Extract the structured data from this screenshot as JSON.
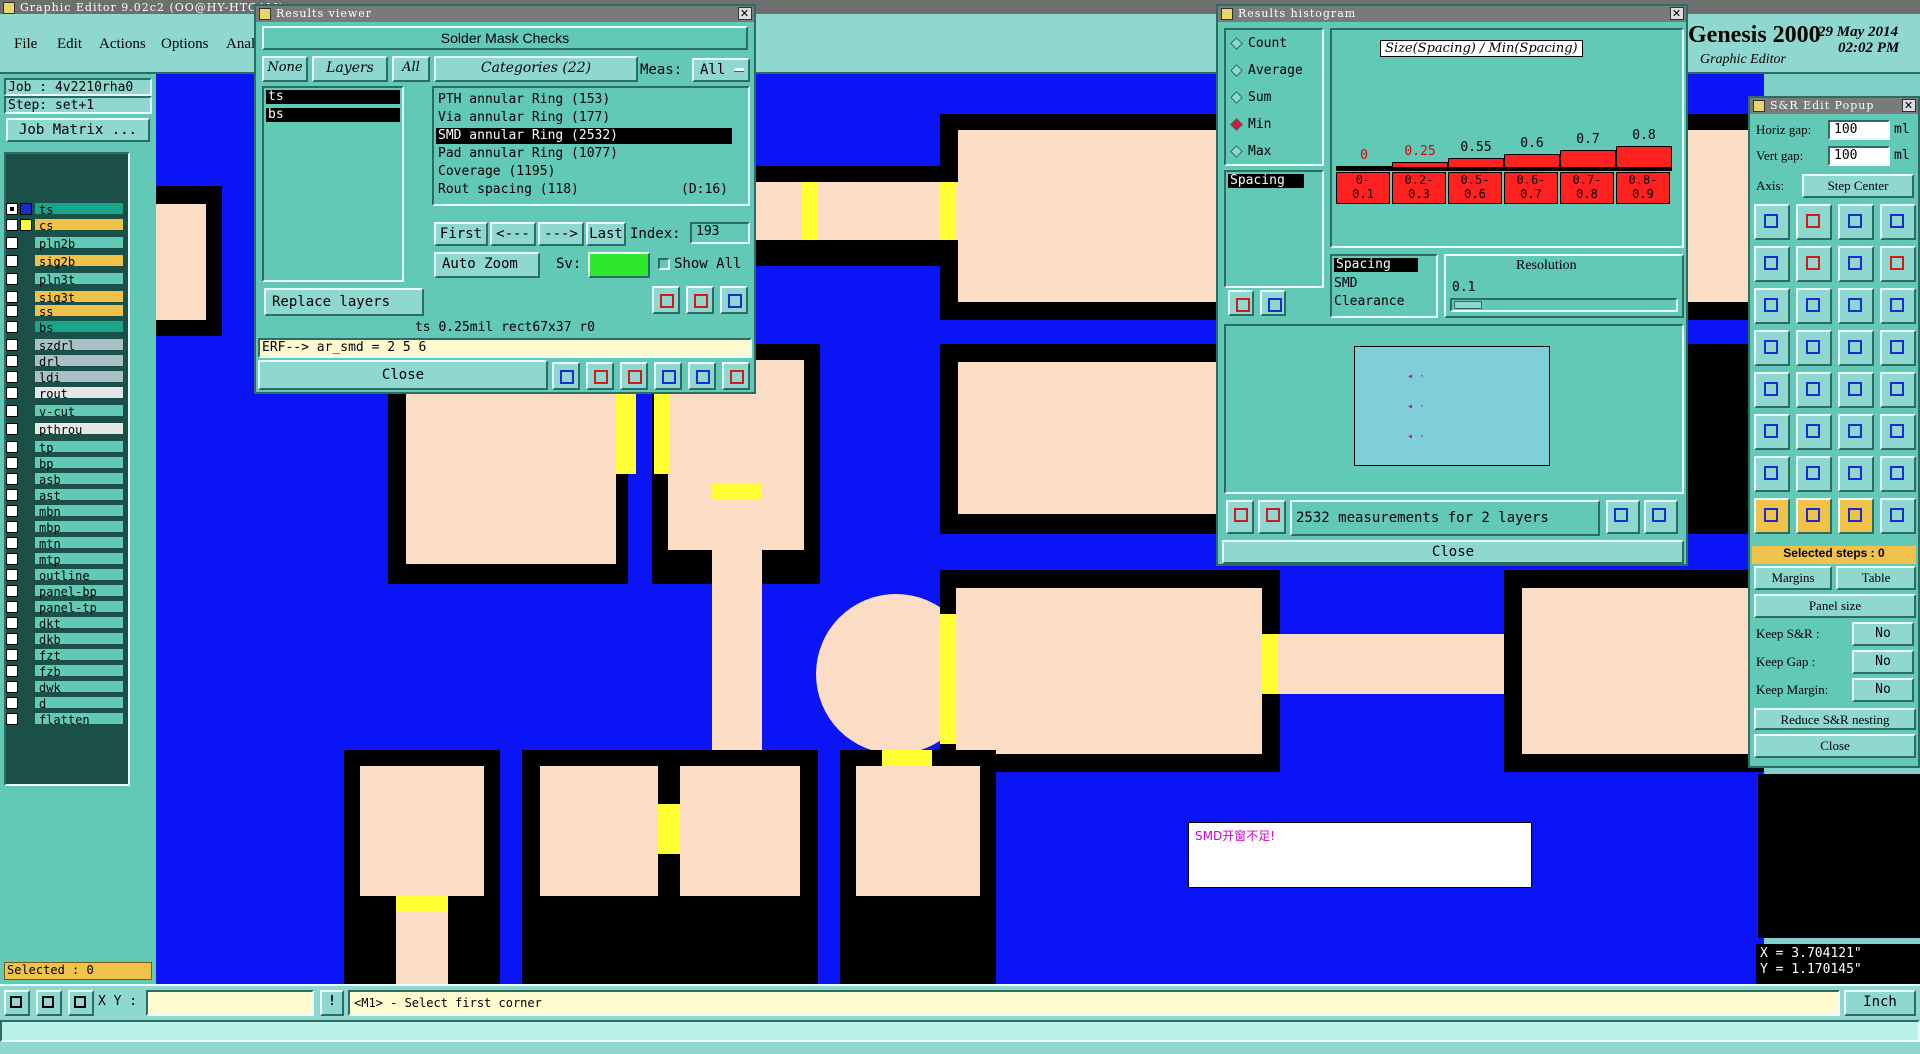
{
  "app": {
    "title": "Graphic Editor 9.02c2  (OO@HY-HTCAM)",
    "menus": [
      "File",
      "Edit",
      "Actions",
      "Options",
      "Anal"
    ],
    "brand": "Genesis 2000",
    "brand_sub": "Graphic Editor",
    "date": "29 May 2014",
    "time": "02:02 PM"
  },
  "left_panel": {
    "job": "Job : 4v2210rha0",
    "step": "Step: set+1",
    "job_matrix": "Job Matrix ...",
    "layers": [
      {
        "name": "ts",
        "color": "#1aa58a",
        "marker": "#1a2bd0",
        "selected": true
      },
      {
        "name": "cs",
        "color": "#f0c24a",
        "marker": "#ffff33"
      },
      {
        "name": "pln2b",
        "color": "#63c9b7"
      },
      {
        "name": "sig2b",
        "color": "#f0c24a"
      },
      {
        "name": "pln3t",
        "color": "#63c9b7"
      },
      {
        "name": "sig3t",
        "color": "#f0c24a"
      },
      {
        "name": "ss",
        "color": "#f0c24a"
      },
      {
        "name": "bs",
        "color": "#1aa58a"
      },
      {
        "name": "szdrl",
        "color": "#a9c0c6"
      },
      {
        "name": "drl",
        "color": "#a9c0c6"
      },
      {
        "name": "ldi",
        "color": "#a9c0c6"
      },
      {
        "name": "rout",
        "color": "#e6e6e6"
      },
      {
        "name": "v-cut",
        "color": "#63c9b7"
      },
      {
        "name": "pthrou",
        "color": "#e6e6e6"
      },
      {
        "name": "tp",
        "color": "#63c9b7"
      },
      {
        "name": "bp",
        "color": "#63c9b7"
      },
      {
        "name": "asb",
        "color": "#63c9b7"
      },
      {
        "name": "ast",
        "color": "#63c9b7"
      },
      {
        "name": "mbn",
        "color": "#63c9b7"
      },
      {
        "name": "mbp",
        "color": "#63c9b7"
      },
      {
        "name": "mtn",
        "color": "#63c9b7"
      },
      {
        "name": "mtp",
        "color": "#63c9b7"
      },
      {
        "name": "outline",
        "color": "#63c9b7"
      },
      {
        "name": "panel-bp",
        "color": "#63c9b7"
      },
      {
        "name": "panel-tp",
        "color": "#63c9b7"
      },
      {
        "name": "dkt",
        "color": "#63c9b7"
      },
      {
        "name": "dkb",
        "color": "#63c9b7"
      },
      {
        "name": "fzt",
        "color": "#63c9b7"
      },
      {
        "name": "fzb",
        "color": "#63c9b7"
      },
      {
        "name": "dwk",
        "color": "#63c9b7"
      },
      {
        "name": "d",
        "color": "#63c9b7"
      },
      {
        "name": "flatten",
        "color": "#63c9b7"
      }
    ],
    "selected": "Selected : 0"
  },
  "results_viewer": {
    "title": "Results viewer",
    "header": "Solder Mask Checks",
    "none_btn": "None",
    "layers_btn": "Layers",
    "all_btn": "All",
    "categories": "Categories (22)",
    "meas_label": "Meas:",
    "meas_value": "All",
    "layers": [
      "ts",
      "bs"
    ],
    "items": [
      {
        "label": "PTH annular Ring (153)",
        "extra": ""
      },
      {
        "label": "Via annular Ring (177)",
        "extra": ""
      },
      {
        "label": "SMD annular Ring (2532)",
        "extra": "",
        "selected": true
      },
      {
        "label": "Pad annular Ring (1077)",
        "extra": ""
      },
      {
        "label": "Coverage (1195)",
        "extra": ""
      },
      {
        "label": "Rout spacing (118)",
        "extra": "(D:16)"
      }
    ],
    "first": "First",
    "prev": "<---",
    "next": "--->",
    "last": "Last",
    "index_label": "Index:",
    "index_value": "193",
    "auto_zoom": "Auto Zoom",
    "sv_label": "Sv:",
    "show_all": "Show All",
    "replace_layers": "Replace layers",
    "status": "ts 0.25mil   rect67x37   r0",
    "erf": "ERF--> ar_smd = 2 5 6",
    "close": "Close",
    "tool_icons": [
      "DEL",
      "REP",
      "UNDO"
    ]
  },
  "histogram": {
    "title": "Results histogram",
    "modes": [
      {
        "label": "Count",
        "on": false
      },
      {
        "label": "Average",
        "on": false
      },
      {
        "label": "Sum",
        "on": false
      },
      {
        "label": "Min",
        "on": true
      },
      {
        "label": "Max",
        "on": false
      }
    ],
    "chart_title": "Size(Spacing) / Min(Spacing)",
    "bins": [
      {
        "range": "0-\n0.1",
        "min": "0"
      },
      {
        "range": "0.2-\n0.3",
        "min": "0.25"
      },
      {
        "range": "0.5-\n0.6",
        "min": "0.55"
      },
      {
        "range": "0.6-\n0.7",
        "min": "0.6"
      },
      {
        "range": "0.7-\n0.8",
        "min": "0.7"
      },
      {
        "range": "0.8-\n0.9",
        "min": "0.8"
      }
    ],
    "list_a": [
      "Spacing"
    ],
    "list_b": [
      "Spacing",
      "SMD",
      "Clearance"
    ],
    "resolution_label": "Resolution",
    "resolution_value": "0.1",
    "measurements": "2532 measurements for 2 layers",
    "close": "Close"
  },
  "sr_popup": {
    "title": "S&R Edit Popup",
    "horiz_label": "Horiz gap:",
    "horiz_value": "100",
    "horiz_unit": "ml",
    "vert_label": "Vert  gap:",
    "vert_value": "100",
    "vert_unit": "ml",
    "axis_label": "Axis:",
    "axis_value": "Step Center",
    "selected_steps": "Selected steps : 0",
    "margins": "Margins",
    "table": "Table",
    "panel_size": "Panel size",
    "keep_sr_label": "Keep S&R   :",
    "keep_sr_value": "No",
    "keep_gap_label": "Keep Gap    :",
    "keep_gap_value": "No",
    "keep_margin_label": "Keep Margin:",
    "keep_margin_value": "No",
    "reduce": "Reduce S&R nesting",
    "close": "Close"
  },
  "canvas": {
    "note": "SMD开窗不足!",
    "coord_x": "X = 3.704121\"",
    "coord_y": "Y = 1.170145\""
  },
  "bottom": {
    "xy_label": "X Y :",
    "xy_value": "",
    "prompt": "<M1> - Select first corner",
    "units": "Inch"
  }
}
